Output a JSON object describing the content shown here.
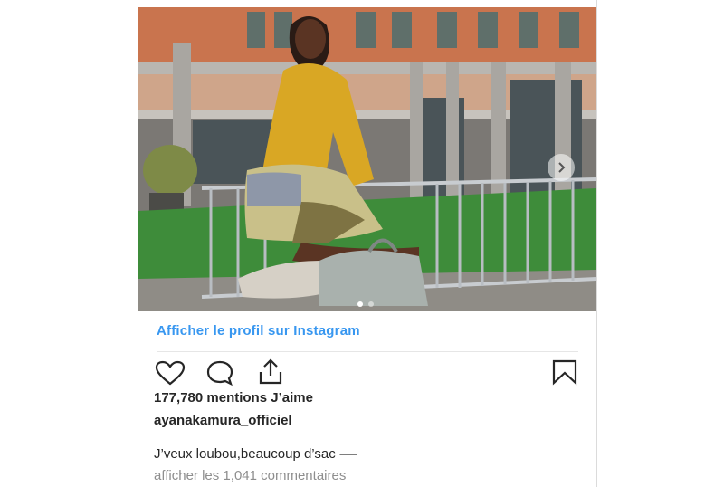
{
  "post": {
    "view_profile_link": "Afficher le profil sur Instagram",
    "likes": "177,780 mentions J’aime",
    "username": "ayanakamura_officiel",
    "caption": "J’veux loubou,beaucoup d’sac ",
    "caption_emoji": "⸺",
    "comments_link": "afficher les 1,041 commentaires",
    "photo_count": 2,
    "current_photo": 1
  },
  "icons": {
    "like": "heart-icon",
    "comment": "comment-icon",
    "share": "share-icon",
    "save": "bookmark-icon",
    "next": "chevron-right-icon"
  },
  "colors": {
    "link": "#3897f0",
    "text": "#262626",
    "muted": "#8e8e8e",
    "border": "#dbdbdb"
  }
}
